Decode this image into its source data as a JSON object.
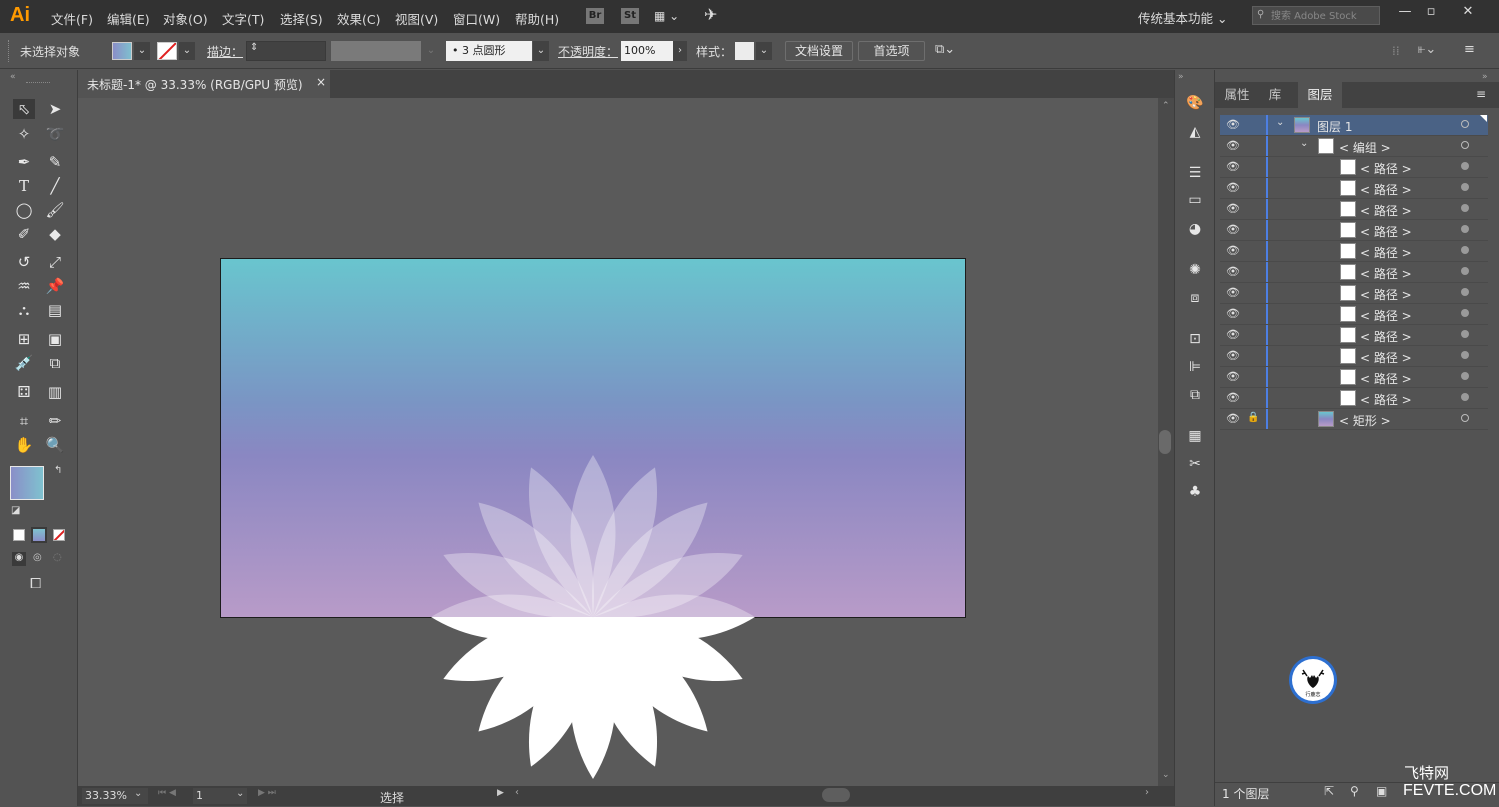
{
  "app": {
    "logo": "Ai",
    "brand_color": "#ff9a00"
  },
  "menu": [
    "文件(F)",
    "编辑(E)",
    "对象(O)",
    "文字(T)",
    "选择(S)",
    "效果(C)",
    "视图(V)",
    "窗口(W)",
    "帮助(H)"
  ],
  "menubar_buttons": {
    "bridge": "Br",
    "stock": "St"
  },
  "workspace": "传统基本功能",
  "search": {
    "placeholder": "搜索 Adobe Stock"
  },
  "control": {
    "selection_status": "未选择对象",
    "stroke_label": "描边：",
    "brush": "3 点圆形",
    "opacity_label": "不透明度：",
    "opacity_value": "100%",
    "style_label": "样式：",
    "doc_settings": "文档设置",
    "preferences": "首选项"
  },
  "document_tab": {
    "title": "未标题-1* @ 33.33% (RGB/GPU 预览)",
    "close": "×"
  },
  "status": {
    "zoom": "33.33%",
    "page": "1",
    "tool": "选择"
  },
  "panel": {
    "tabs": [
      "属性",
      "库",
      "图层"
    ],
    "active_tab": "图层",
    "layers": [
      {
        "name": "图层 1",
        "kind": "layer"
      },
      {
        "name": "< 编组 >",
        "kind": "group"
      },
      {
        "name": "< 路径 >",
        "kind": "path"
      },
      {
        "name": "< 路径 >",
        "kind": "path"
      },
      {
        "name": "< 路径 >",
        "kind": "path"
      },
      {
        "name": "< 路径 >",
        "kind": "path"
      },
      {
        "name": "< 路径 >",
        "kind": "path"
      },
      {
        "name": "< 路径 >",
        "kind": "path"
      },
      {
        "name": "< 路径 >",
        "kind": "path"
      },
      {
        "name": "< 路径 >",
        "kind": "path"
      },
      {
        "name": "< 路径 >",
        "kind": "path"
      },
      {
        "name": "< 路径 >",
        "kind": "path"
      },
      {
        "name": "< 路径 >",
        "kind": "path"
      },
      {
        "name": "< 路径 >",
        "kind": "path"
      },
      {
        "name": "< 矩形 >",
        "kind": "rect"
      }
    ],
    "layer_count": "1 个图层"
  },
  "watermark": {
    "line1": "飞特网",
    "line2": "FEVTE.COM"
  },
  "colors": {
    "artboard_top": "#69c5ce",
    "artboard_mid": "#8a87c2",
    "artboard_bottom": "#b89bc8",
    "selection_blue": "#4d7fe3"
  }
}
